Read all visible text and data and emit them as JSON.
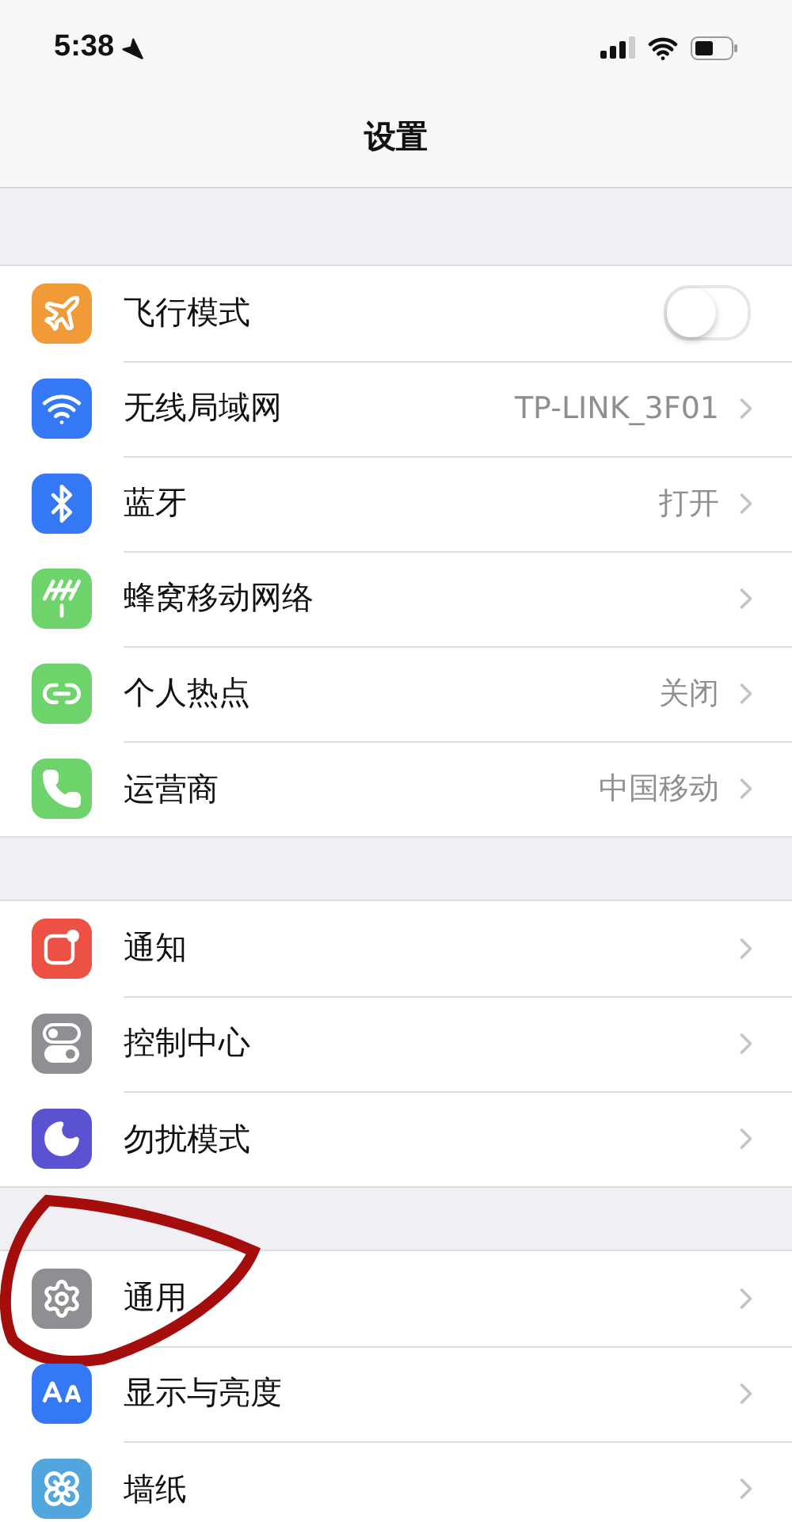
{
  "status_bar": {
    "time": "5:38"
  },
  "nav_bar": {
    "title": "设置"
  },
  "groups": [
    {
      "rows": [
        {
          "kind": "toggle",
          "label": "飞行模式",
          "color": "#f19a38",
          "on": false
        },
        {
          "kind": "link",
          "label": "无线局域网",
          "value": "TP-LINK_3F01",
          "color": "#3478f6"
        },
        {
          "kind": "link",
          "label": "蓝牙",
          "value": "打开",
          "color": "#3478f6"
        },
        {
          "kind": "link",
          "label": "蜂窝移动网络",
          "color": "#6dd36a"
        },
        {
          "kind": "link",
          "label": "个人热点",
          "value": "关闭",
          "color": "#6dd36a"
        },
        {
          "kind": "link",
          "label": "运营商",
          "value": "中国移动",
          "color": "#6dd36a"
        }
      ]
    },
    {
      "rows": [
        {
          "kind": "link",
          "label": "通知",
          "color": "#ec5143"
        },
        {
          "kind": "link",
          "label": "控制中心",
          "color": "#8e8e93"
        },
        {
          "kind": "link",
          "label": "勿扰模式",
          "color": "#5a52d0"
        }
      ]
    },
    {
      "rows": [
        {
          "kind": "link",
          "label": "通用",
          "color": "#8e8e93",
          "circled": true
        },
        {
          "kind": "link",
          "label": "显示与亮度",
          "color": "#3478f6"
        },
        {
          "kind": "link",
          "label": "墙纸",
          "color": "#51a6dd"
        }
      ]
    }
  ]
}
